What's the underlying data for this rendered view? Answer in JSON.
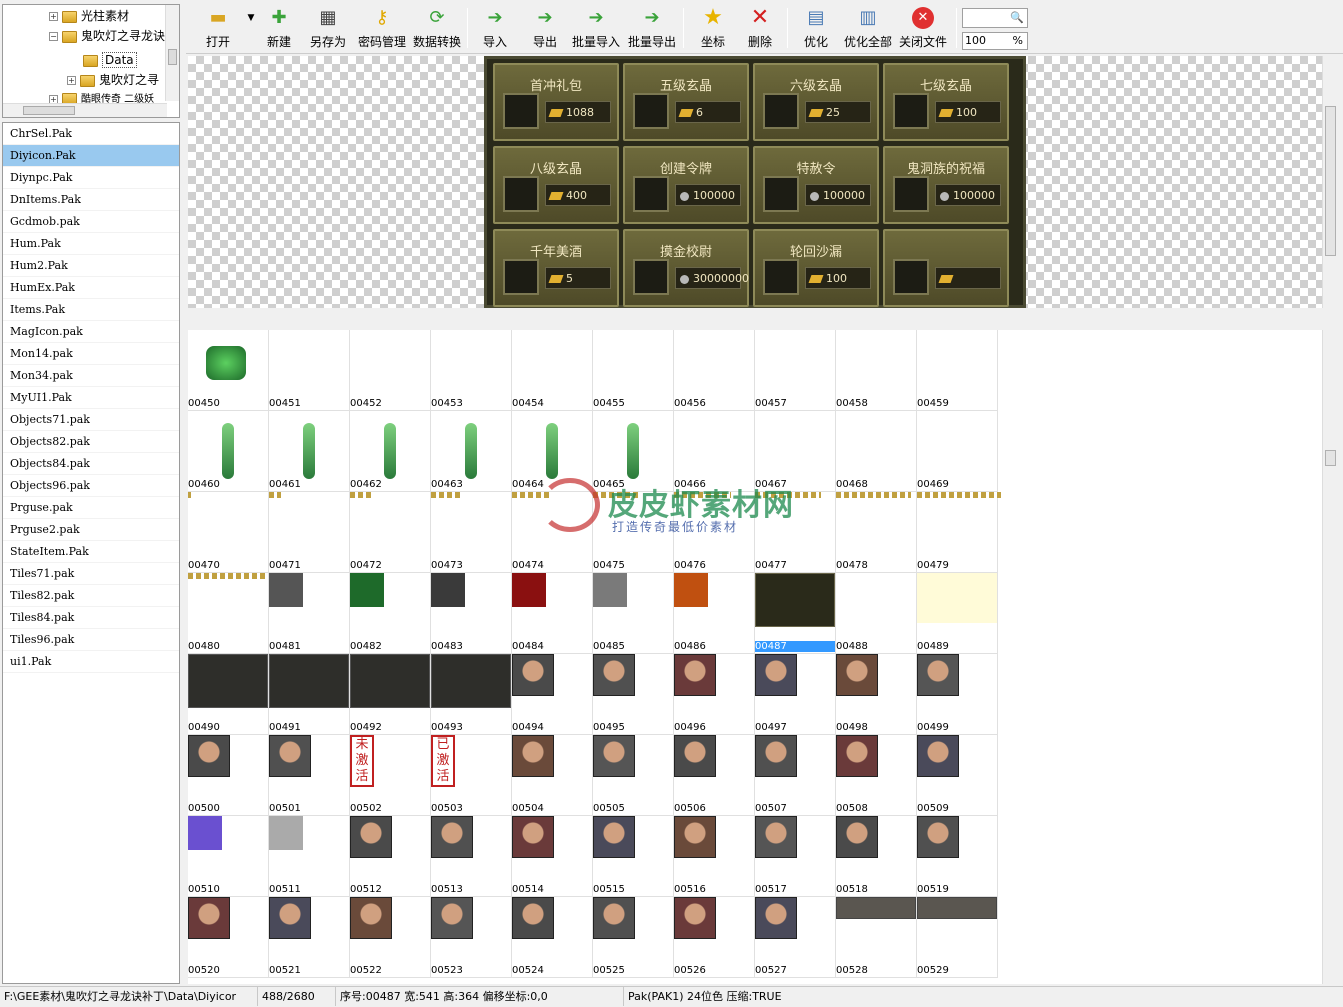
{
  "tree": {
    "items": [
      {
        "label": "光柱素材",
        "indent": 1,
        "expander": "+"
      },
      {
        "label": "鬼吹灯之寻龙诀",
        "indent": 1,
        "expander": "−"
      },
      {
        "label": "Data",
        "indent": 2,
        "expander": "",
        "selected": true
      },
      {
        "label": "鬼吹灯之寻",
        "indent": 2,
        "expander": "+"
      },
      {
        "label": "酷眼传奇 二级妖",
        "indent": 1,
        "expander": "+"
      }
    ]
  },
  "files": [
    "ChrSel.Pak",
    "Diyicon.Pak",
    "Diynpc.Pak",
    "DnItems.Pak",
    "Gcdmob.pak",
    "Hum.Pak",
    "Hum2.Pak",
    "HumEx.Pak",
    "Items.Pak",
    "MagIcon.pak",
    "Mon14.pak",
    "Mon34.pak",
    "MyUI1.Pak",
    "Objects71.pak",
    "Objects82.pak",
    "Objects84.pak",
    "Objects96.pak",
    "Prguse.pak",
    "Prguse2.pak",
    "StateItem.Pak",
    "Tiles71.pak",
    "Tiles82.pak",
    "Tiles84.pak",
    "Tiles96.pak",
    "ui1.Pak"
  ],
  "selected_file": "Diyicon.Pak",
  "toolbar": {
    "open": "打开",
    "new": "新建",
    "save_as": "另存为",
    "password": "密码管理",
    "convert": "数据转换",
    "import": "导入",
    "export": "导出",
    "batch_import": "批量导入",
    "batch_export": "批量导出",
    "coord": "坐标",
    "delete": "删除",
    "optimize": "优化",
    "optimize_all": "优化全部",
    "close_file": "关闭文件",
    "search_value": "",
    "zoom_value": "100",
    "zoom_unit": "%"
  },
  "preview": {
    "slots": [
      {
        "name": "首冲礼包",
        "price": "1088",
        "cur": "gold"
      },
      {
        "name": "五级玄晶",
        "price": "6",
        "cur": "gold"
      },
      {
        "name": "六级玄晶",
        "price": "25",
        "cur": "gold"
      },
      {
        "name": "七级玄晶",
        "price": "100",
        "cur": "gold"
      },
      {
        "name": "八级玄晶",
        "price": "400",
        "cur": "gold"
      },
      {
        "name": "创建令牌",
        "price": "100000",
        "cur": "coin"
      },
      {
        "name": "特赦令",
        "price": "100000",
        "cur": "coin"
      },
      {
        "name": "鬼洞族的祝福",
        "price": "100000",
        "cur": "coin"
      },
      {
        "name": "千年美酒",
        "price": "5",
        "cur": "gold"
      },
      {
        "name": "摸金校尉",
        "price": "30000000",
        "cur": "coin"
      },
      {
        "name": "轮回沙漏",
        "price": "100",
        "cur": "gold"
      },
      {
        "name": "",
        "price": "",
        "cur": "gold"
      }
    ]
  },
  "grid": {
    "ids": [
      "00450",
      "00451",
      "00452",
      "00453",
      "00454",
      "00455",
      "00456",
      "00457",
      "00458",
      "00459",
      "00460",
      "00461",
      "00462",
      "00463",
      "00464",
      "00465",
      "00466",
      "00467",
      "00468",
      "00469",
      "00470",
      "00471",
      "00472",
      "00473",
      "00474",
      "00475",
      "00476",
      "00477",
      "00478",
      "00479",
      "00480",
      "00481",
      "00482",
      "00483",
      "00484",
      "00485",
      "00486",
      "00487",
      "00488",
      "00489",
      "00490",
      "00491",
      "00492",
      "00493",
      "00494",
      "00495",
      "00496",
      "00497",
      "00498",
      "00499",
      "00500",
      "00501",
      "00502",
      "00503",
      "00504",
      "00505",
      "00506",
      "00507",
      "00508",
      "00509",
      "00510",
      "00511",
      "00512",
      "00513",
      "00514",
      "00515",
      "00516",
      "00517",
      "00518",
      "00519",
      "00520",
      "00521",
      "00522",
      "00523",
      "00524",
      "00525",
      "00526",
      "00527",
      "00528",
      "00529"
    ],
    "selected_id": "00487",
    "stamps": {
      "00502": "未激活",
      "00503": "已激活"
    }
  },
  "watermark": {
    "title": "皮皮虾素材网",
    "subtitle": "打造传奇最低价素材"
  },
  "status": {
    "path": "F:\\GEE素材\\鬼吹灯之寻龙诀补丁\\Data\\Diyicor",
    "count": "488/2680",
    "info": "序号:00487 宽:541 高:364 偏移坐标:0,0",
    "format": "Pak(PAK1) 24位色 压缩:TRUE"
  },
  "colors": {
    "selection": "#99c9ef",
    "grid_selection": "#3399ff",
    "accent_green": "#3aa33a"
  }
}
